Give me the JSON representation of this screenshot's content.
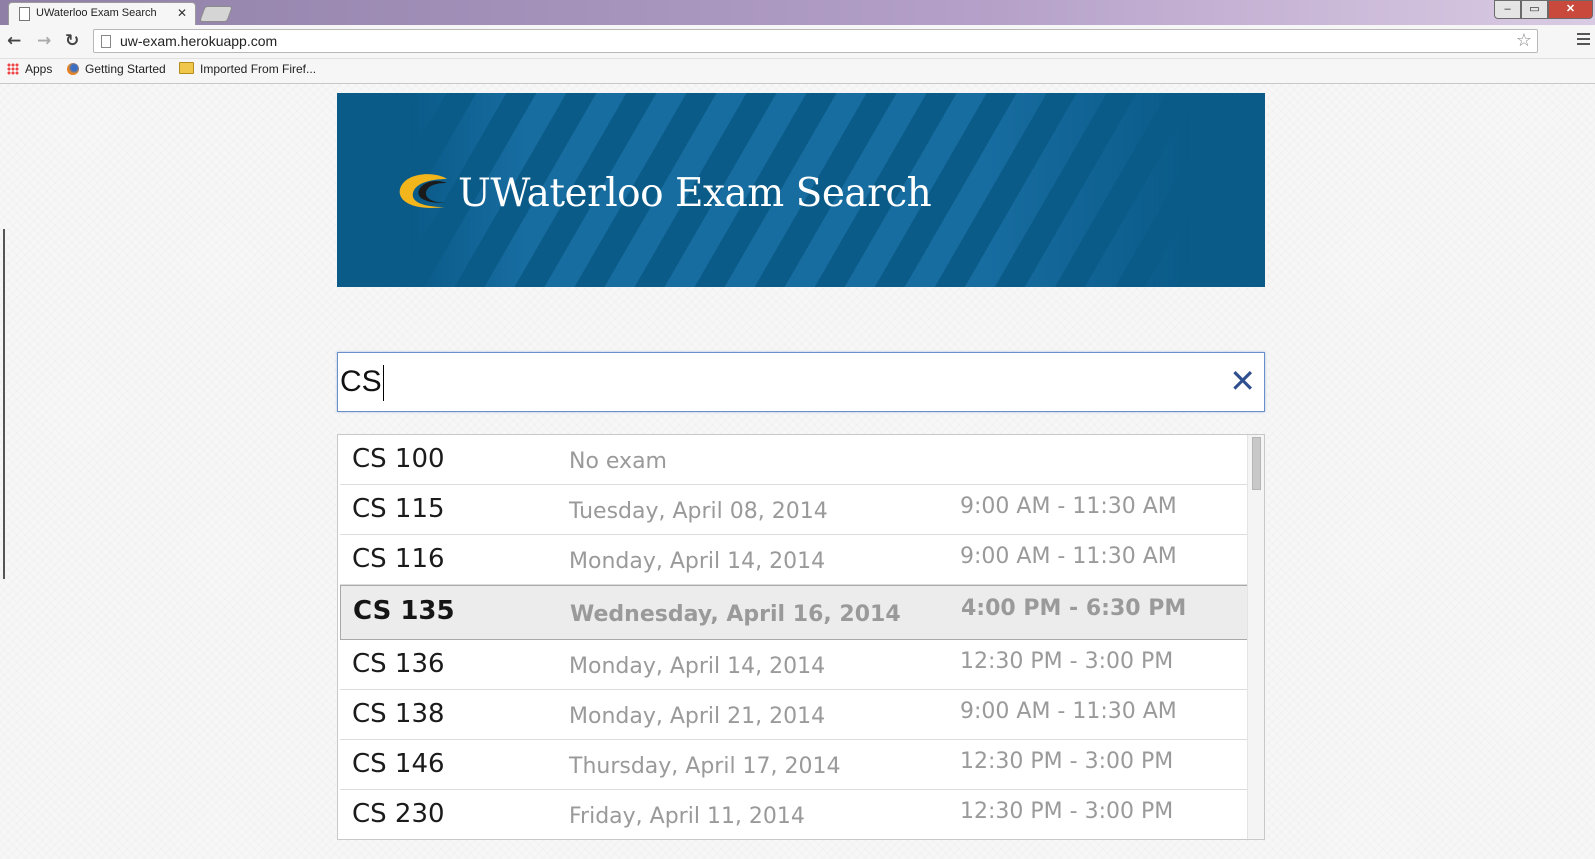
{
  "browser": {
    "tab_title": "UWaterloo Exam Search",
    "tab_close": "✕",
    "url": "uw-exam.herokuapp.com",
    "bookmarks": [
      {
        "label": "Apps"
      },
      {
        "label": "Getting Started"
      },
      {
        "label": "Imported From Firef..."
      }
    ],
    "window_controls": {
      "min": "–",
      "max": "▭",
      "close": "✕"
    }
  },
  "banner": {
    "title": "UWaterloo Exam Search",
    "colors": {
      "background": "#0a5b88",
      "logo_gold": "#f2b51c"
    }
  },
  "search": {
    "value": "CS",
    "clear_icon": "✕"
  },
  "results": [
    {
      "course": "CS 100",
      "date": "No exam",
      "time": ""
    },
    {
      "course": "CS 115",
      "date": "Tuesday, April 08, 2014",
      "time": "9:00 AM - 11:30 AM"
    },
    {
      "course": "CS 116",
      "date": "Monday, April 14, 2014",
      "time": "9:00 AM - 11:30 AM"
    },
    {
      "course": "CS 135",
      "date": "Wednesday, April 16, 2014",
      "time": "4:00 PM - 6:30 PM",
      "highlighted": true
    },
    {
      "course": "CS 136",
      "date": "Monday, April 14, 2014",
      "time": "12:30 PM - 3:00 PM"
    },
    {
      "course": "CS 138",
      "date": "Monday, April 21, 2014",
      "time": "9:00 AM - 11:30 AM"
    },
    {
      "course": "CS 146",
      "date": "Thursday, April 17, 2014",
      "time": "12:30 PM - 3:00 PM"
    },
    {
      "course": "CS 230",
      "date": "Friday, April 11, 2014",
      "time": "12:30 PM - 3:00 PM"
    }
  ]
}
